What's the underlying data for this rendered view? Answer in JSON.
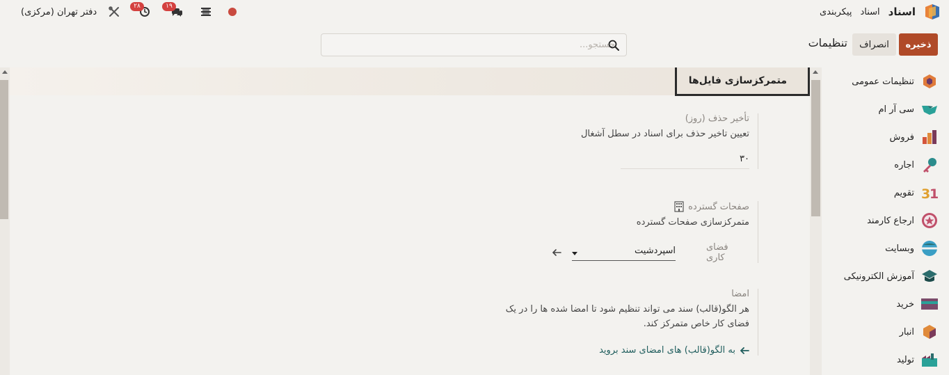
{
  "navbar": {
    "app_name": "اسناد",
    "menu": [
      "اسناد",
      "پیکربندی"
    ],
    "company": "دفتر تهران (مرکزی)",
    "activity_count": "۲۸",
    "message_count": "۱۹"
  },
  "control_panel": {
    "save_label": "ذخیره",
    "discard_label": "انصراف",
    "title": "تنظیمات",
    "search_placeholder": "جستجو..."
  },
  "sidebar": {
    "items": [
      {
        "label": "تنظیمات عمومی",
        "icon": "general-settings-icon",
        "color": "#e07b3a"
      },
      {
        "label": "سی آر ام",
        "icon": "crm-handshake-icon",
        "color": "#2aa198"
      },
      {
        "label": "فروش",
        "icon": "sales-chart-icon",
        "color": "#d4553b"
      },
      {
        "label": "اجاره",
        "icon": "rental-key-icon",
        "color": "#2b8c8c"
      },
      {
        "label": "تقویم",
        "icon": "calendar-icon",
        "color": "#e0a030"
      },
      {
        "label": "ارجاع کارمند",
        "icon": "referral-star-icon",
        "color": "#c0506a"
      },
      {
        "label": "وبسایت",
        "icon": "website-globe-icon",
        "color": "#3a9ec4"
      },
      {
        "label": "آموزش الکترونیکی",
        "icon": "elearning-cap-icon",
        "color": "#2b6c6c"
      },
      {
        "label": "خرید",
        "icon": "purchase-card-icon",
        "color": "#7a4a6a"
      },
      {
        "label": "انبار",
        "icon": "inventory-box-icon",
        "color": "#e08a3a"
      },
      {
        "label": "تولید",
        "icon": "manufacturing-icon",
        "color": "#2aa198"
      }
    ]
  },
  "section": {
    "title": "متمرکزسازی فایل‌ها"
  },
  "settings": {
    "deletion_delay": {
      "label": "تأخیر حذف (روز)",
      "description": "تعیین تاخیر حذف برای اسناد در سطل آشغال",
      "value": "۳۰"
    },
    "spreadsheets": {
      "label": "صفحات گسترده",
      "description": "متمرکزسازی صفحات گسترده",
      "workspace_label": "فضای کاری",
      "workspace_value": "اسپردشیت"
    },
    "sign": {
      "label": "امضا",
      "description_line1": "هر الگو(قالب) سند می تواند تنظیم شود تا امضا شده ها را در یک",
      "description_line2": "فضای کار خاص متمرکز کند.",
      "link": "به الگو(قالب) های امضای سند بروید"
    }
  }
}
